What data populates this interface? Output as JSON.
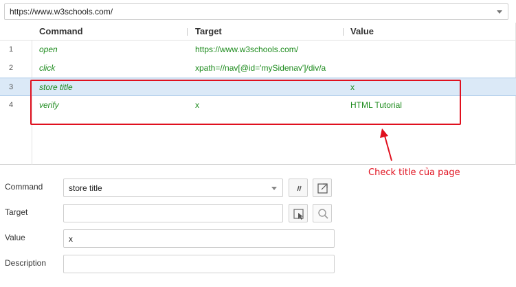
{
  "url_bar": {
    "value": "https://www.w3schools.com/"
  },
  "table": {
    "headers": {
      "command": "Command",
      "target": "Target",
      "value": "Value"
    },
    "rows": [
      {
        "num": "1",
        "command": "open",
        "target": "https://www.w3schools.com/",
        "value": ""
      },
      {
        "num": "2",
        "command": "click",
        "target": "xpath=//nav[@id='mySidenav']/div/a",
        "value": ""
      },
      {
        "num": "3",
        "command": "store title",
        "target": "",
        "value": "x"
      },
      {
        "num": "4",
        "command": "verify",
        "target": "x",
        "value": "HTML Tutorial"
      }
    ],
    "selected_row": 3
  },
  "annotation": {
    "text": "Check title của page",
    "color": "#e0101e"
  },
  "form": {
    "command": {
      "label": "Command",
      "value": "store title"
    },
    "target": {
      "label": "Target",
      "value": ""
    },
    "value": {
      "label": "Value",
      "value": "x"
    },
    "description": {
      "label": "Description",
      "value": ""
    }
  },
  "icons": {
    "toggle_comment": "comment-toggle-icon",
    "open_reference": "open-external-icon",
    "select_target": "select-target-icon",
    "find_target": "search-icon"
  },
  "colors": {
    "command_text": "#1b8a1b",
    "selected_row": "#dbe9f7"
  }
}
